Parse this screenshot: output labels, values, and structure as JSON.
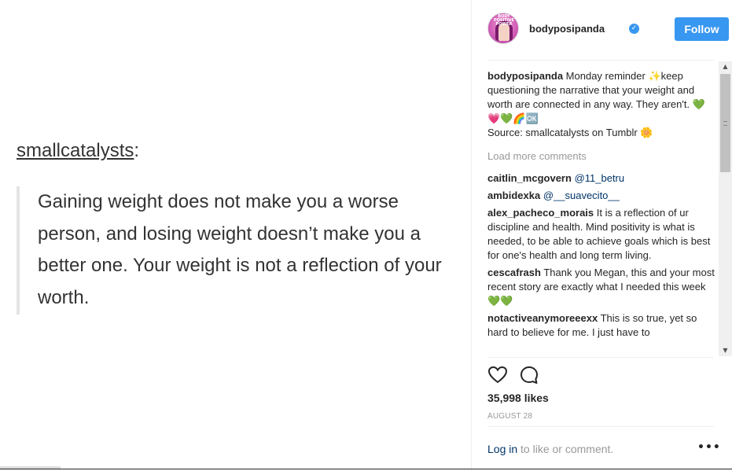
{
  "post_image": {
    "author": "smallcatalysts",
    "author_suffix": ":",
    "quote": "Gaining weight does not make you a worse person, and losing weight doesn’t make you a better one. Your weight is not a reflection of your worth."
  },
  "header": {
    "username": "bodyposipanda",
    "verified_icon": "verified-badge-icon",
    "verified_glyph": "✓",
    "follow_label": "Follow",
    "avatar_text": "BODY POSITIVE POWER"
  },
  "caption": {
    "user": "bodyposipanda",
    "text": " Monday reminder ✨keep questioning the narrative that your weight and worth are connected in any way. They aren't. 💚💗💚🌈🆗",
    "source": "Source: smallcatalysts on Tumblr 🌼"
  },
  "load_more": "Load more comments",
  "comments": [
    {
      "user": "caitlin_mcgovern",
      "text": "",
      "mention": "@11_betru"
    },
    {
      "user": "ambidexka",
      "text": "",
      "mention": "@__suavecito__"
    },
    {
      "user": "alex_pacheco_morais",
      "text": " It is a reflection of ur discipline and health. Mind positivity is what is needed, to be able to achieve goals which is best for one's health and long term living.",
      "mention": ""
    },
    {
      "user": "cescafrash",
      "text": " Thank you Megan, this and your most recent story are exactly what I needed this week 💚💚",
      "mention": ""
    },
    {
      "user": "notactiveanymoreeexx",
      "text": " This is so true, yet so hard to believe for me. I just have to",
      "mention": ""
    }
  ],
  "actions": {
    "like_icon": "heart-icon",
    "comment_icon": "comment-icon"
  },
  "likes": "35,998 likes",
  "date": "AUGUST 28",
  "login": {
    "link": "Log in",
    "text": " to like or comment."
  },
  "more_label": "•••",
  "scrollbar": {
    "up": "▲",
    "down": "▼"
  }
}
